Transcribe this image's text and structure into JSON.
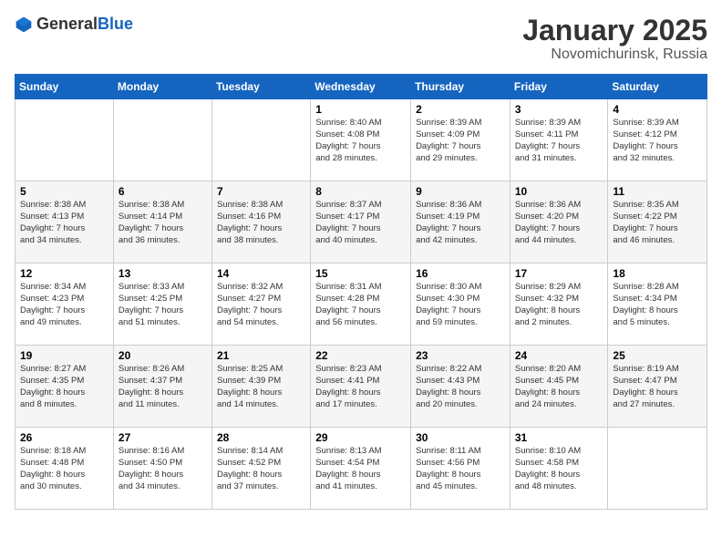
{
  "header": {
    "logo_general": "General",
    "logo_blue": "Blue",
    "month": "January 2025",
    "location": "Novomichurinsk, Russia"
  },
  "weekdays": [
    "Sunday",
    "Monday",
    "Tuesday",
    "Wednesday",
    "Thursday",
    "Friday",
    "Saturday"
  ],
  "weeks": [
    [
      {
        "day": "",
        "details": ""
      },
      {
        "day": "",
        "details": ""
      },
      {
        "day": "",
        "details": ""
      },
      {
        "day": "1",
        "details": "Sunrise: 8:40 AM\nSunset: 4:08 PM\nDaylight: 7 hours\nand 28 minutes."
      },
      {
        "day": "2",
        "details": "Sunrise: 8:39 AM\nSunset: 4:09 PM\nDaylight: 7 hours\nand 29 minutes."
      },
      {
        "day": "3",
        "details": "Sunrise: 8:39 AM\nSunset: 4:11 PM\nDaylight: 7 hours\nand 31 minutes."
      },
      {
        "day": "4",
        "details": "Sunrise: 8:39 AM\nSunset: 4:12 PM\nDaylight: 7 hours\nand 32 minutes."
      }
    ],
    [
      {
        "day": "5",
        "details": "Sunrise: 8:38 AM\nSunset: 4:13 PM\nDaylight: 7 hours\nand 34 minutes."
      },
      {
        "day": "6",
        "details": "Sunrise: 8:38 AM\nSunset: 4:14 PM\nDaylight: 7 hours\nand 36 minutes."
      },
      {
        "day": "7",
        "details": "Sunrise: 8:38 AM\nSunset: 4:16 PM\nDaylight: 7 hours\nand 38 minutes."
      },
      {
        "day": "8",
        "details": "Sunrise: 8:37 AM\nSunset: 4:17 PM\nDaylight: 7 hours\nand 40 minutes."
      },
      {
        "day": "9",
        "details": "Sunrise: 8:36 AM\nSunset: 4:19 PM\nDaylight: 7 hours\nand 42 minutes."
      },
      {
        "day": "10",
        "details": "Sunrise: 8:36 AM\nSunset: 4:20 PM\nDaylight: 7 hours\nand 44 minutes."
      },
      {
        "day": "11",
        "details": "Sunrise: 8:35 AM\nSunset: 4:22 PM\nDaylight: 7 hours\nand 46 minutes."
      }
    ],
    [
      {
        "day": "12",
        "details": "Sunrise: 8:34 AM\nSunset: 4:23 PM\nDaylight: 7 hours\nand 49 minutes."
      },
      {
        "day": "13",
        "details": "Sunrise: 8:33 AM\nSunset: 4:25 PM\nDaylight: 7 hours\nand 51 minutes."
      },
      {
        "day": "14",
        "details": "Sunrise: 8:32 AM\nSunset: 4:27 PM\nDaylight: 7 hours\nand 54 minutes."
      },
      {
        "day": "15",
        "details": "Sunrise: 8:31 AM\nSunset: 4:28 PM\nDaylight: 7 hours\nand 56 minutes."
      },
      {
        "day": "16",
        "details": "Sunrise: 8:30 AM\nSunset: 4:30 PM\nDaylight: 7 hours\nand 59 minutes."
      },
      {
        "day": "17",
        "details": "Sunrise: 8:29 AM\nSunset: 4:32 PM\nDaylight: 8 hours\nand 2 minutes."
      },
      {
        "day": "18",
        "details": "Sunrise: 8:28 AM\nSunset: 4:34 PM\nDaylight: 8 hours\nand 5 minutes."
      }
    ],
    [
      {
        "day": "19",
        "details": "Sunrise: 8:27 AM\nSunset: 4:35 PM\nDaylight: 8 hours\nand 8 minutes."
      },
      {
        "day": "20",
        "details": "Sunrise: 8:26 AM\nSunset: 4:37 PM\nDaylight: 8 hours\nand 11 minutes."
      },
      {
        "day": "21",
        "details": "Sunrise: 8:25 AM\nSunset: 4:39 PM\nDaylight: 8 hours\nand 14 minutes."
      },
      {
        "day": "22",
        "details": "Sunrise: 8:23 AM\nSunset: 4:41 PM\nDaylight: 8 hours\nand 17 minutes."
      },
      {
        "day": "23",
        "details": "Sunrise: 8:22 AM\nSunset: 4:43 PM\nDaylight: 8 hours\nand 20 minutes."
      },
      {
        "day": "24",
        "details": "Sunrise: 8:20 AM\nSunset: 4:45 PM\nDaylight: 8 hours\nand 24 minutes."
      },
      {
        "day": "25",
        "details": "Sunrise: 8:19 AM\nSunset: 4:47 PM\nDaylight: 8 hours\nand 27 minutes."
      }
    ],
    [
      {
        "day": "26",
        "details": "Sunrise: 8:18 AM\nSunset: 4:48 PM\nDaylight: 8 hours\nand 30 minutes."
      },
      {
        "day": "27",
        "details": "Sunrise: 8:16 AM\nSunset: 4:50 PM\nDaylight: 8 hours\nand 34 minutes."
      },
      {
        "day": "28",
        "details": "Sunrise: 8:14 AM\nSunset: 4:52 PM\nDaylight: 8 hours\nand 37 minutes."
      },
      {
        "day": "29",
        "details": "Sunrise: 8:13 AM\nSunset: 4:54 PM\nDaylight: 8 hours\nand 41 minutes."
      },
      {
        "day": "30",
        "details": "Sunrise: 8:11 AM\nSunset: 4:56 PM\nDaylight: 8 hours\nand 45 minutes."
      },
      {
        "day": "31",
        "details": "Sunrise: 8:10 AM\nSunset: 4:58 PM\nDaylight: 8 hours\nand 48 minutes."
      },
      {
        "day": "",
        "details": ""
      }
    ]
  ]
}
